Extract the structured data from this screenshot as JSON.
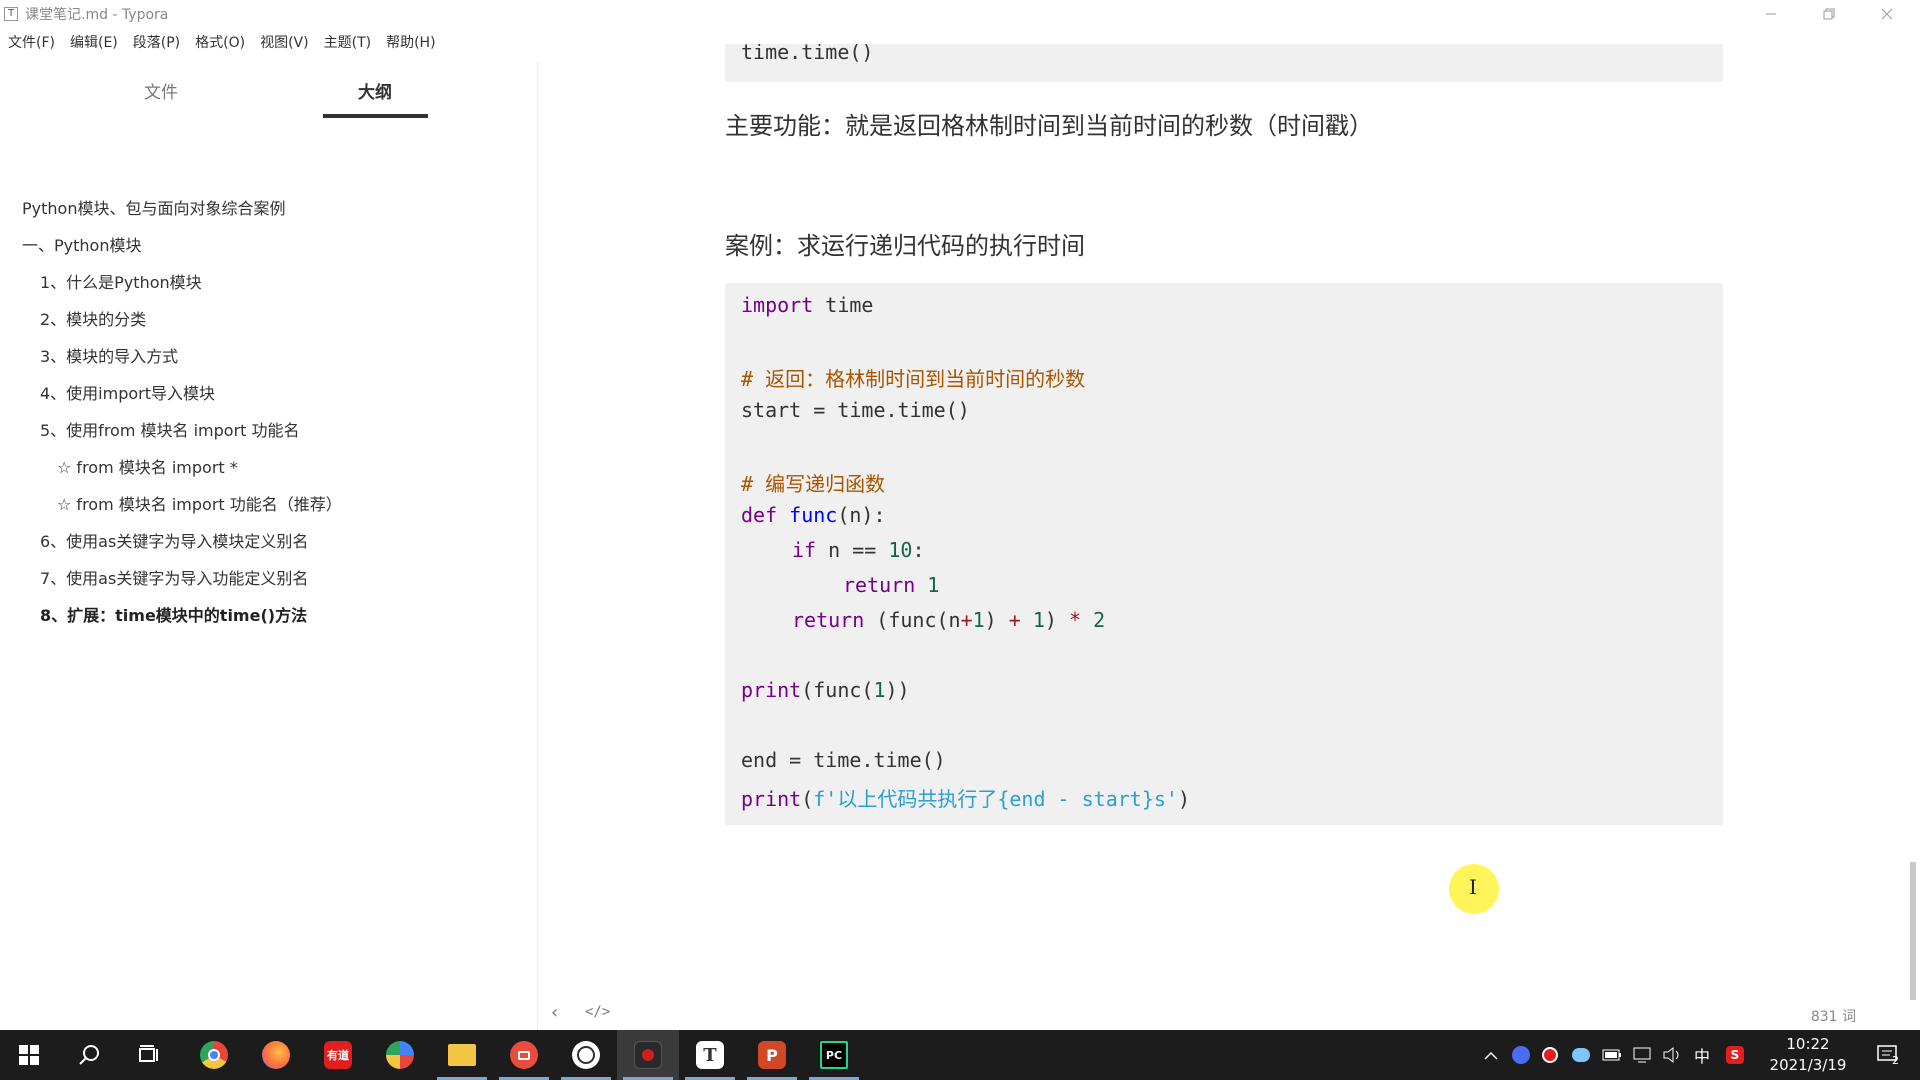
{
  "window": {
    "title": "课堂笔记.md - Typora",
    "app_icon": "T",
    "controls": [
      "minimize",
      "restore",
      "close"
    ]
  },
  "menu": [
    "文件(F)",
    "编辑(E)",
    "段落(P)",
    "格式(O)",
    "视图(V)",
    "主题(T)",
    "帮助(H)"
  ],
  "sidebar": {
    "tabs": [
      "文件",
      "大纲"
    ],
    "active_tab": "大纲",
    "outline": [
      "Python模块、包与面向对象综合案例",
      "一、Python模块",
      "1、什么是Python模块",
      "2、模块的分类",
      "3、模块的导入方式",
      "4、使用import导入模块",
      "5、使用from 模块名 import 功能名",
      "☆ from 模块名 import *",
      "☆ from 模块名 import 功能名（推荐）",
      "6、使用as关键字为导入模块定义别名",
      "7、使用as关键字为导入功能定义别名",
      "8、扩展：time模块中的time()方法"
    ]
  },
  "editor": {
    "top_code": "time.time()",
    "main_function": "主要功能：就是返回格林制时间到当前时间的秒数（时间戳）",
    "case_heading": "案例：求运行递归代码的执行时间",
    "code": {
      "l1_kw": "import",
      "l1_rest": " time",
      "l3_comment": "# 返回：格林制时间到当前时间的秒数",
      "l4": "start = time.time()",
      "l6_comment": "# 编写递归函数",
      "l7_kw": "def",
      "l7_fn": "func",
      "l7_rest": "(n):",
      "l8_kw": "if",
      "l8_mid": " n == ",
      "l8_num": "10",
      "l8_end": ":",
      "l9_kw": "return",
      "l9_num": "1",
      "l10_kw": "return",
      "l10_a": " (func(n",
      "l10_op1": "+",
      "l10_n1": "1",
      "l10_b": ") ",
      "l10_op2": "+",
      "l10_n2": " 1",
      "l10_c": ") ",
      "l10_op3": "*",
      "l10_n3": " 2",
      "l12_kw": "print",
      "l12_a": "(func(",
      "l12_num": "1",
      "l12_b": "))",
      "l14": "end = time.time()",
      "l15_kw": "print",
      "l15_a": "(",
      "l15_str": "f'以上代码共执行了{end - start}s'",
      "l15_b": ")"
    },
    "cursor_glyph": "I"
  },
  "statusbar": {
    "back": "‹",
    "source": "</>",
    "word_count": "831 词"
  },
  "taskbar": {
    "apps": [
      {
        "name": "chrome",
        "label": "",
        "color": "#e8453c"
      },
      {
        "name": "firefox",
        "label": "",
        "color": "#ff7139"
      },
      {
        "name": "youdao",
        "label": "有道",
        "color": "#e01f1f"
      },
      {
        "name": "photos",
        "label": "",
        "color": "#4285f4"
      },
      {
        "name": "explorer",
        "label": "",
        "color": "#f4c542"
      },
      {
        "name": "recorder",
        "label": "",
        "color": "#e84c3d"
      },
      {
        "name": "clock-app",
        "label": "",
        "color": "#ffffff"
      },
      {
        "name": "record",
        "label": "",
        "color": "#cc1f1f"
      },
      {
        "name": "typora",
        "label": "T",
        "color": "#ffffff"
      },
      {
        "name": "powerpoint",
        "label": "P",
        "color": "#d24726"
      },
      {
        "name": "pycharm",
        "label": "PC",
        "color": "#21d789"
      }
    ],
    "tray_ime": "中",
    "clock_time": "10:22",
    "clock_date": "2021/3/19",
    "notification_count": "2"
  }
}
